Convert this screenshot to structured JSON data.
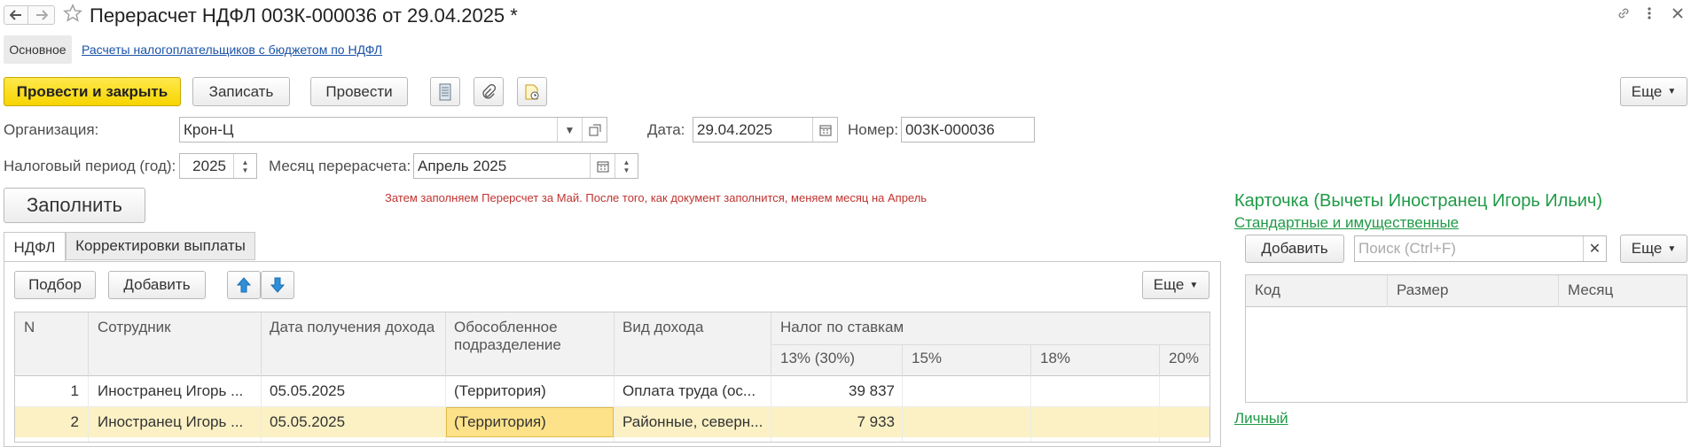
{
  "window": {
    "title": "Перерасчет НДФЛ 003К-000036 от 29.04.2025 *"
  },
  "nav": {
    "main": "Основное",
    "link": "Расчеты налогоплательщиков с бюджетом по НДФЛ"
  },
  "toolbar": {
    "post_close": "Провести и закрыть",
    "save": "Записать",
    "post": "Провести",
    "more": "Еще"
  },
  "form": {
    "org_label": "Организация:",
    "org_value": "Крон-Ц",
    "date_label": "Дата:",
    "date_value": "29.04.2025",
    "number_label": "Номер:",
    "number_value": "003К-000036",
    "period_label": "Налоговый период (год):",
    "period_value": "2025",
    "month_label": "Месяц перерасчета:",
    "month_value": "Апрель 2025",
    "fill_button": "Заполнить",
    "note": "Затем заполняем Перерсчет за Май. После того, как документ заполнится, меняем месяц на Апрель"
  },
  "tabs": [
    {
      "label": "НДФЛ"
    },
    {
      "label": "Корректировки выплаты"
    }
  ],
  "table_toolbar": {
    "select": "Подбор",
    "add": "Добавить",
    "more": "Еще"
  },
  "table": {
    "headers": {
      "n": "N",
      "employee": "Сотрудник",
      "date": "Дата получения дохода",
      "division": "Обособленное подразделение",
      "income_type": "Вид дохода",
      "tax_by_rates": "Налог по ставкам",
      "r13": "13% (30%)",
      "r15": "15%",
      "r18": "18%",
      "r20": "20%"
    },
    "rows": [
      {
        "n": "1",
        "employee": "Иностранец Игорь ...",
        "date": "05.05.2025",
        "division": "(Территория)",
        "income_type": "Оплата труда (ос...",
        "r13": "39 837",
        "r15": "",
        "r18": "",
        "r20": ""
      },
      {
        "n": "2",
        "employee": "Иностранец Игорь ...",
        "date": "05.05.2025",
        "division": "(Территория)",
        "income_type": "Районные, северн...",
        "r13": "7 933",
        "r15": "",
        "r18": "",
        "r20": ""
      }
    ]
  },
  "card": {
    "title": "Карточка (Вычеты Иностранец Игорь Ильич)",
    "subtitle": "Стандартные и имущественные",
    "add": "Добавить",
    "search_placeholder": "Поиск (Ctrl+F)",
    "more": "Еще",
    "col_code": "Код",
    "col_size": "Размер",
    "col_month": "Месяц",
    "personal_link": "Личный"
  },
  "colors": {
    "accent_yellow": "#f7d400",
    "selected_row": "#fbf1c4",
    "selected_cell": "#fde28a",
    "link_blue": "#1a52a8",
    "green": "#1f9a47",
    "note_red": "#c0332f"
  }
}
